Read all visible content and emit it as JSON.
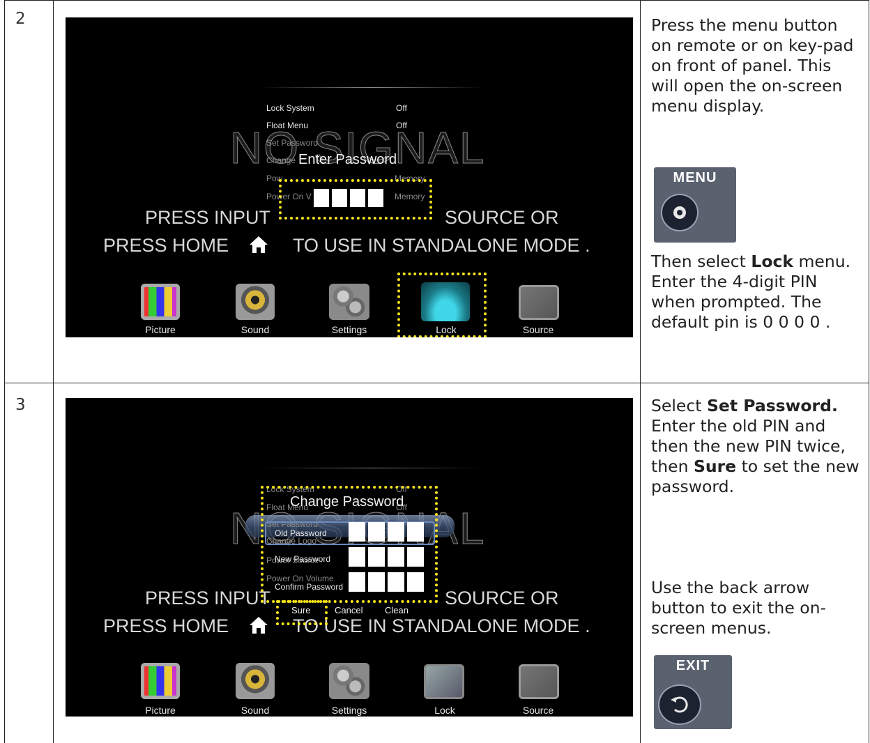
{
  "rows": [
    {
      "step": "2",
      "screen": {
        "menu_items": [
          {
            "label": "Lock System",
            "value": "Off"
          },
          {
            "label": "Float Menu",
            "value": "Off"
          },
          {
            "label": "Set Password",
            "value": ""
          },
          {
            "label": "Change",
            "value": ""
          },
          {
            "label": "Pow",
            "value": "Memory"
          },
          {
            "label": "Power On V",
            "value": "Memory"
          }
        ],
        "background_text": "NO SIGNAL",
        "line1": "PRESS INPUT",
        "line1_end": "SOURCE OR",
        "line2_start": "PRESS HOME",
        "line2_end": "TO USE IN STANDALONE MODE .",
        "dialog_title": "Enter Password",
        "icons": [
          "Picture",
          "Sound",
          "Settings",
          "Lock",
          "Source"
        ]
      },
      "instructions": {
        "p1": "Press the menu button on remote or on key-pad on front of panel.  This will open the on-screen menu display.",
        "button_label": "MENU",
        "p2_before": "Then select ",
        "p2_bold": "Lock",
        "p2_after": " menu.  Enter the 4-digit PIN when prompted.  The default pin is 0 0 0 0 ."
      }
    },
    {
      "step": "3",
      "screen": {
        "menu_items": [
          {
            "label": "Lock System",
            "value": "Off"
          },
          {
            "label": "Float Menu",
            "value": "Off"
          },
          {
            "label": "Set Password",
            "value": ""
          },
          {
            "label": "Change Logo",
            "value": ""
          },
          {
            "label": "Power Source",
            "value": ""
          },
          {
            "label": "Power On Volume",
            "value": ""
          }
        ],
        "background_text": "NO SIGNAL",
        "line1": "PRESS INPUT",
        "line1_end": "SOURCE OR",
        "line2_start": "PRESS HOME",
        "line2_end": "TO USE IN STANDALONE MODE .",
        "dialog_title": "Change Password",
        "fields": [
          "Old Password",
          "New Password",
          "Confirm Password"
        ],
        "buttons": [
          "Sure",
          "Cancel",
          "Clean"
        ],
        "icons": [
          "Picture",
          "Sound",
          "Settings",
          "Lock",
          "Source"
        ]
      },
      "instructions": {
        "p1_before": "Select ",
        "p1_bold": "Set Password.",
        "p1_mid": " Enter the old PIN and then the new PIN twice, then ",
        "p1_bold2": "Sure",
        "p1_after": " to set the new password.",
        "p2": "Use the back arrow button to exit the on-screen menus.",
        "button_label": "EXIT"
      }
    }
  ]
}
